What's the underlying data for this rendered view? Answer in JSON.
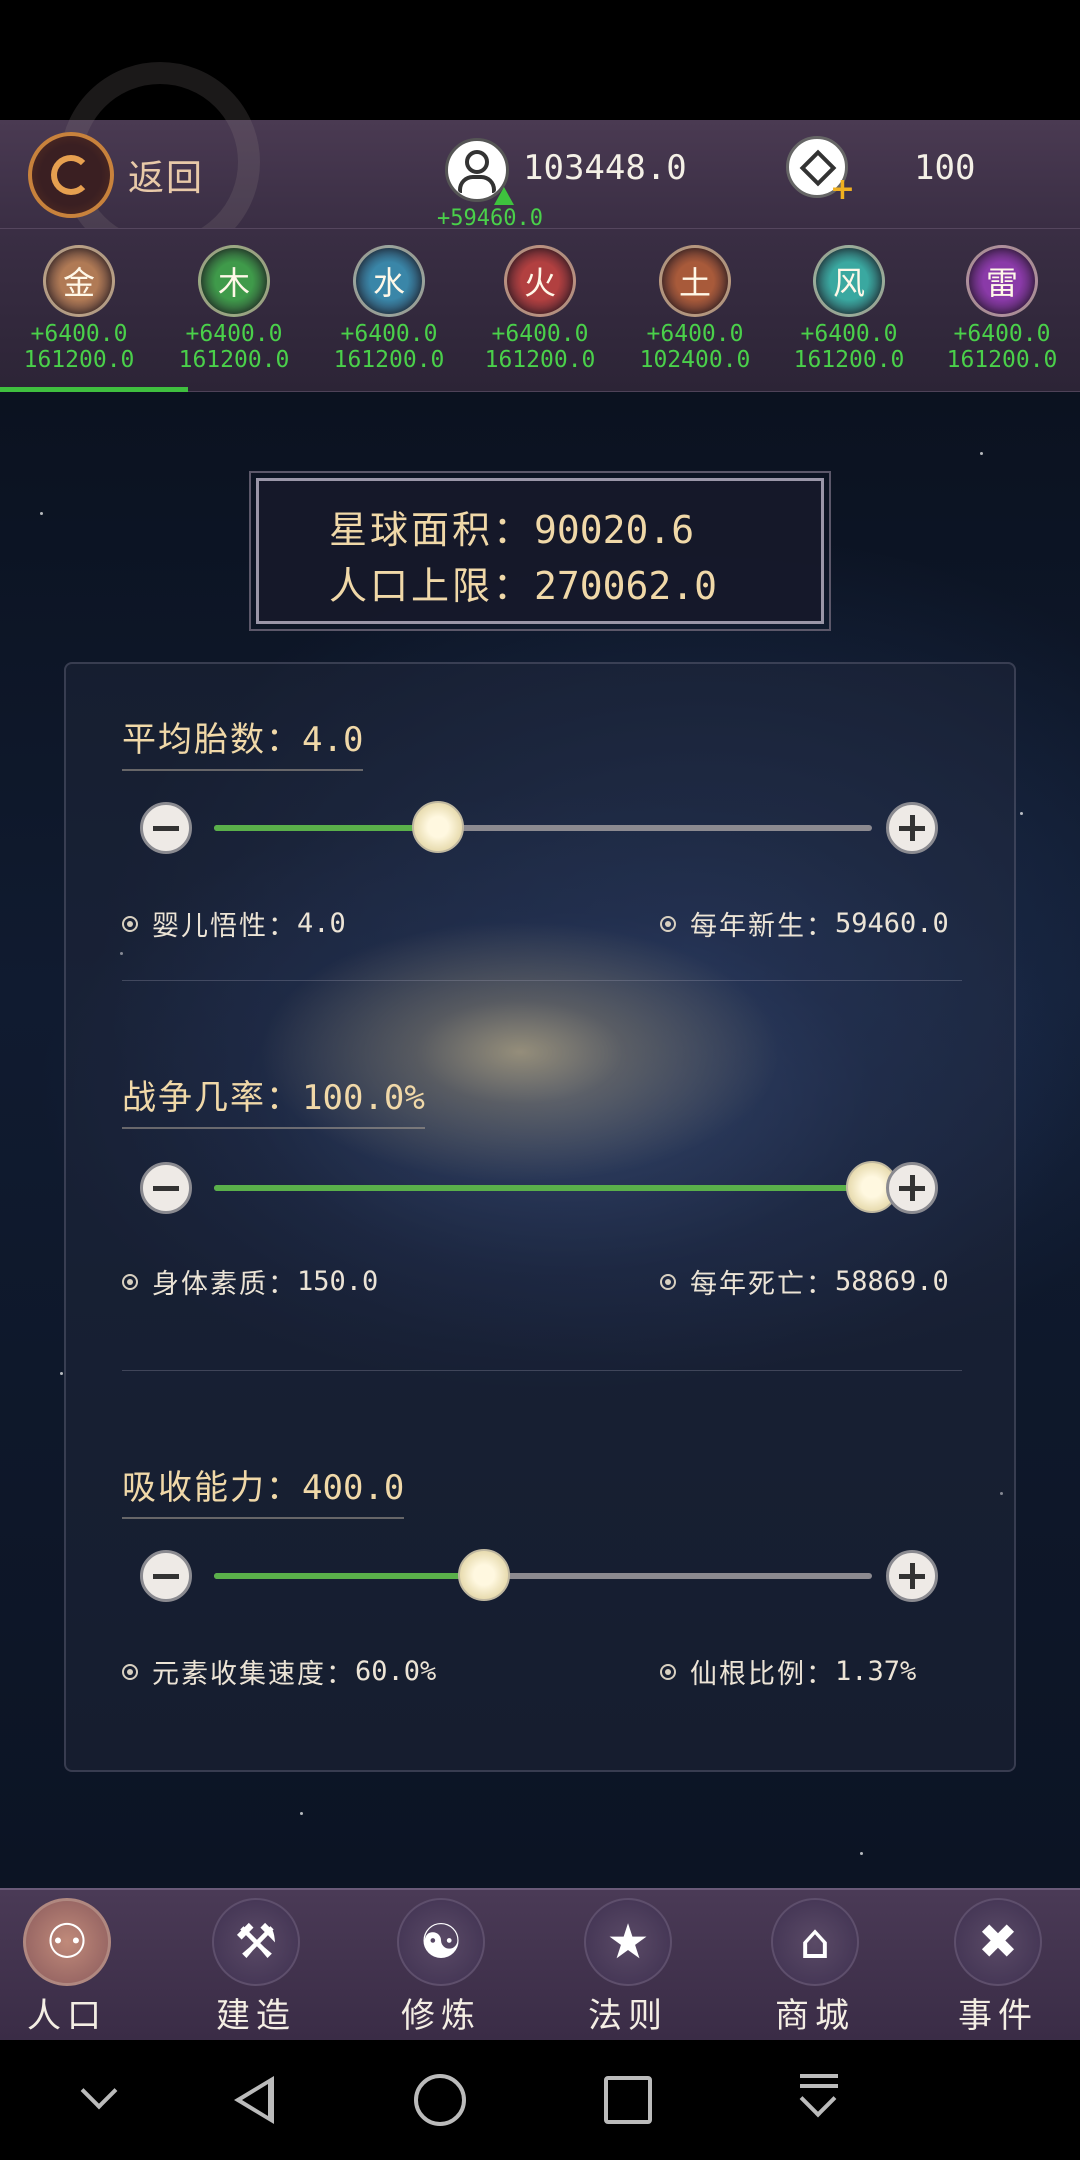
{
  "header": {
    "back_label": "返回",
    "population_value": "103448.0",
    "population_delta": "+59460.0",
    "gems_value": "100"
  },
  "elements": [
    {
      "name": "金",
      "color": "#b07a55",
      "rate": "+6400.0",
      "total": "161200.0"
    },
    {
      "name": "木",
      "color": "#3f9a4a",
      "rate": "+6400.0",
      "total": "161200.0"
    },
    {
      "name": "水",
      "color": "#3a86a8",
      "rate": "+6400.0",
      "total": "161200.0"
    },
    {
      "name": "火",
      "color": "#b24040",
      "rate": "+6400.0",
      "total": "161200.0"
    },
    {
      "name": "土",
      "color": "#a85a3a",
      "rate": "+6400.0",
      "total": "102400.0"
    },
    {
      "name": "风",
      "color": "#3aa8a0",
      "rate": "+6400.0",
      "total": "161200.0"
    },
    {
      "name": "雷",
      "color": "#8a3aa8",
      "rate": "+6400.0",
      "total": "161200.0"
    }
  ],
  "planet": {
    "area_label": "星球面积：",
    "area_value": "90020.6",
    "cap_label": "人口上限：",
    "cap_value": "270062.0"
  },
  "sections": [
    {
      "title": "平均胎数：",
      "value": "4.0",
      "slider_fraction": 0.34,
      "left_label": "婴儿悟性：",
      "left_value": "4.0",
      "right_label": "每年新生：",
      "right_value": "59460.0"
    },
    {
      "title": "战争几率：",
      "value": "100.0%",
      "slider_fraction": 1.0,
      "left_label": "身体素质：",
      "left_value": "150.0",
      "right_label": "每年死亡：",
      "right_value": "58869.0"
    },
    {
      "title": "吸收能力：",
      "value": "400.0",
      "slider_fraction": 0.41,
      "left_label": "元素收集速度：",
      "left_value": "60.0%",
      "right_label": "仙根比例：",
      "right_value": "1.37%"
    }
  ],
  "nav": [
    {
      "label": "人口",
      "icon": "population-icon",
      "active": true
    },
    {
      "label": "建造",
      "icon": "build-icon",
      "active": false
    },
    {
      "label": "修炼",
      "icon": "cultivate-icon",
      "active": false
    },
    {
      "label": "法则",
      "icon": "law-icon",
      "active": false
    },
    {
      "label": "商城",
      "icon": "shop-icon",
      "active": false
    },
    {
      "label": "事件",
      "icon": "event-icon",
      "active": false
    }
  ]
}
